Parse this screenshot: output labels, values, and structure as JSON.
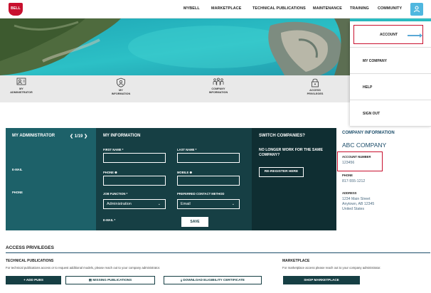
{
  "brand": {
    "logo_text": "BELL"
  },
  "nav": {
    "items": [
      "MYBELL",
      "MARKETPLACE",
      "TECHNICAL PUBLICATIONS",
      "MAINTENANCE",
      "TRAINING",
      "COMMUNITY"
    ]
  },
  "tabs": [
    {
      "label": "MY\nADMINISTRATOR",
      "icon": "admin-icon"
    },
    {
      "label": "MY\nINFORMATION",
      "icon": "user-shield-icon"
    },
    {
      "label": "COMPANY\nINFORMATION",
      "icon": "people-icon"
    },
    {
      "label": "ACCESS\nPRIVILEGES",
      "icon": "lock-icon"
    }
  ],
  "dropdown": {
    "items": [
      "ACCOUNT",
      "MY COMPANY",
      "HELP",
      "SIGN OUT"
    ]
  },
  "admin": {
    "title": "MY ADMINISTRATOR",
    "pager": "1/19",
    "email_label": "E-MAIL",
    "phone_label": "PHONE"
  },
  "info": {
    "title": "MY INFORMATION",
    "first_name_label": "FIRST NAME *",
    "last_name_label": "LAST NAME *",
    "phone_label": "PHONE",
    "mobile_label": "MOBILE",
    "job_function_label": "JOB FUNCTION *",
    "job_function_value": "Administration",
    "contact_method_label": "PREFERRED CONTACT METHOD",
    "contact_method_value": "Email",
    "email_label": "E-MAIL *",
    "save_label": "SAVE"
  },
  "switch": {
    "title": "SWITCH COMPANIES?",
    "prompt": "NO LONGER WORK FOR THE SAME COMPANY?",
    "button": "RE-REGISTER HERE"
  },
  "company": {
    "title": "COMPANY INFORMATION",
    "name": "ABC COMPANY",
    "account_number_label": "ACCOUNT NUMBER",
    "account_number": "123456",
    "phone_label": "PHONE",
    "phone": "817-555-1212",
    "address_label": "ADDRESS",
    "address_line1": "1234 Main Street",
    "address_line2": "Anytown, AB 12345",
    "address_line3": "United States"
  },
  "access": {
    "title": "ACCESS PRIVILEGES",
    "tech_title": "TECHNICAL PUBLICATIONS",
    "tech_text": "For technical publications access or to request additional models, please reach out to your company administrator.",
    "add_pubs": "ADD PUBS",
    "missing_pubs": "MISSING PUBLICATIONS",
    "download_cert": "DOWNLOAD ELIGIBILITY CERTIFICATE",
    "market_title": "MARKETPLACE",
    "market_text": "For marketplace access please reach out to your company administrator.",
    "shop": "SHOP MARKETPLACE"
  },
  "colors": {
    "brand_red": "#c8102e",
    "accent_blue": "#4fb7df",
    "panel_dark": "#163f44",
    "panel_teal": "#1d6169",
    "panel_darkest": "#0f2e32"
  }
}
